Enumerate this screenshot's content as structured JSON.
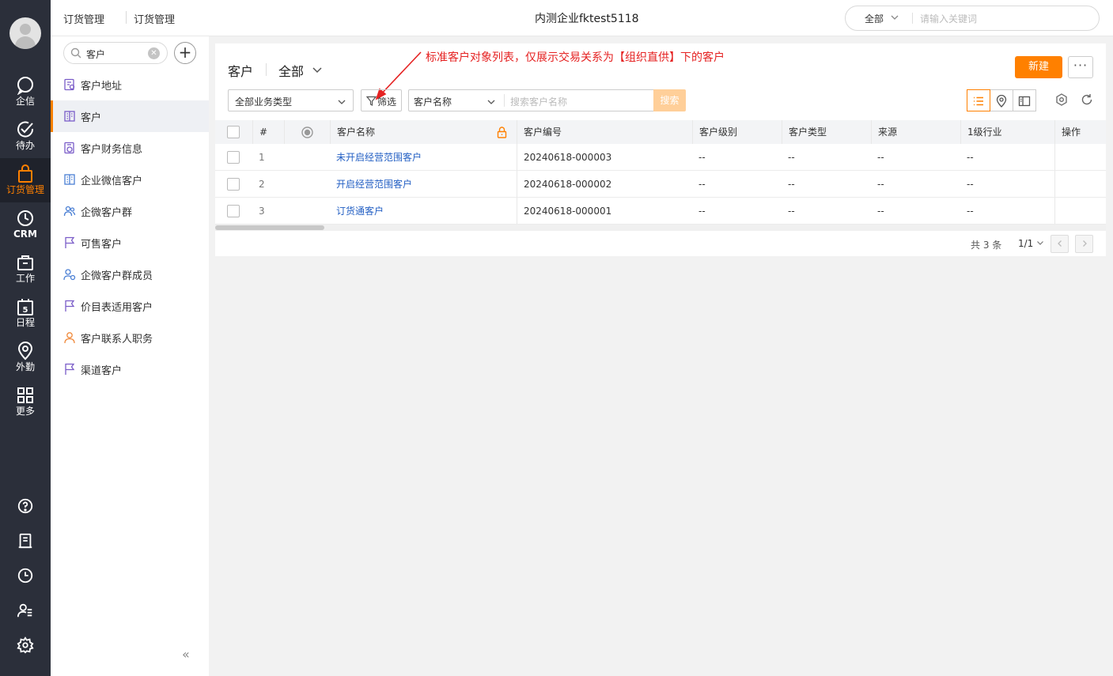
{
  "rail": {
    "items": [
      {
        "label": "企信",
        "icon": "chat-icon"
      },
      {
        "label": "待办",
        "icon": "check-circle-icon"
      },
      {
        "label": "订货管理",
        "icon": "shopping-bag-icon",
        "active": true
      },
      {
        "label": "CRM",
        "icon": "clock-chart-icon"
      },
      {
        "label": "工作",
        "icon": "briefcase-icon"
      },
      {
        "label": "日程",
        "icon": "calendar-icon",
        "badge": "5"
      },
      {
        "label": "外勤",
        "icon": "location-pin-icon"
      },
      {
        "label": "更多",
        "icon": "grid-icon"
      }
    ],
    "bottom_icons": [
      "help-icon",
      "notebook-icon",
      "history-icon",
      "contacts-icon",
      "settings-icon"
    ]
  },
  "topbar": {
    "crumb1": "订货管理",
    "crumb2": "订货管理",
    "company": "内测企业fktest5118",
    "search_scope": "全部",
    "search_placeholder": "请输入关键词"
  },
  "sidebar": {
    "search_value": "客户",
    "items": [
      {
        "label": "客户地址"
      },
      {
        "label": "客户",
        "active": true
      },
      {
        "label": "客户财务信息"
      },
      {
        "label": "企业微信客户"
      },
      {
        "label": "企微客户群"
      },
      {
        "label": "可售客户"
      },
      {
        "label": "企微客户群成员"
      },
      {
        "label": "价目表适用客户"
      },
      {
        "label": "客户联系人职务"
      },
      {
        "label": "渠道客户"
      }
    ],
    "collapse_label": "«"
  },
  "panel": {
    "title": "客户",
    "scope": "全部",
    "annotation": "标准客户对象列表，仅展示交易关系为【组织直供】下的客户",
    "new_label": "新建",
    "more_label": "···",
    "type_select": "全部业务类型",
    "filter_label": "筛选",
    "search_field": "客户名称",
    "search_placeholder": "搜索客户名称",
    "search_button": "搜索"
  },
  "table": {
    "columns": [
      "#",
      "客户名称",
      "客户编号",
      "客户级别",
      "客户类型",
      "来源",
      "1级行业",
      "操作"
    ],
    "rows": [
      {
        "idx": "1",
        "name": "未开启经营范围客户",
        "code": "20240618-000003",
        "level": "--",
        "type": "--",
        "source": "--",
        "industry": "--"
      },
      {
        "idx": "2",
        "name": "开启经营范围客户",
        "code": "20240618-000002",
        "level": "--",
        "type": "--",
        "source": "--",
        "industry": "--"
      },
      {
        "idx": "3",
        "name": "订货通客户",
        "code": "20240618-000001",
        "level": "--",
        "type": "--",
        "source": "--",
        "industry": "--"
      }
    ]
  },
  "pager": {
    "total": "共 3 条",
    "page": "1/1"
  },
  "colors": {
    "accent": "#ff8000",
    "rail_bg": "#2b2f3a",
    "link": "#2460c4",
    "annotation": "#e52222"
  }
}
